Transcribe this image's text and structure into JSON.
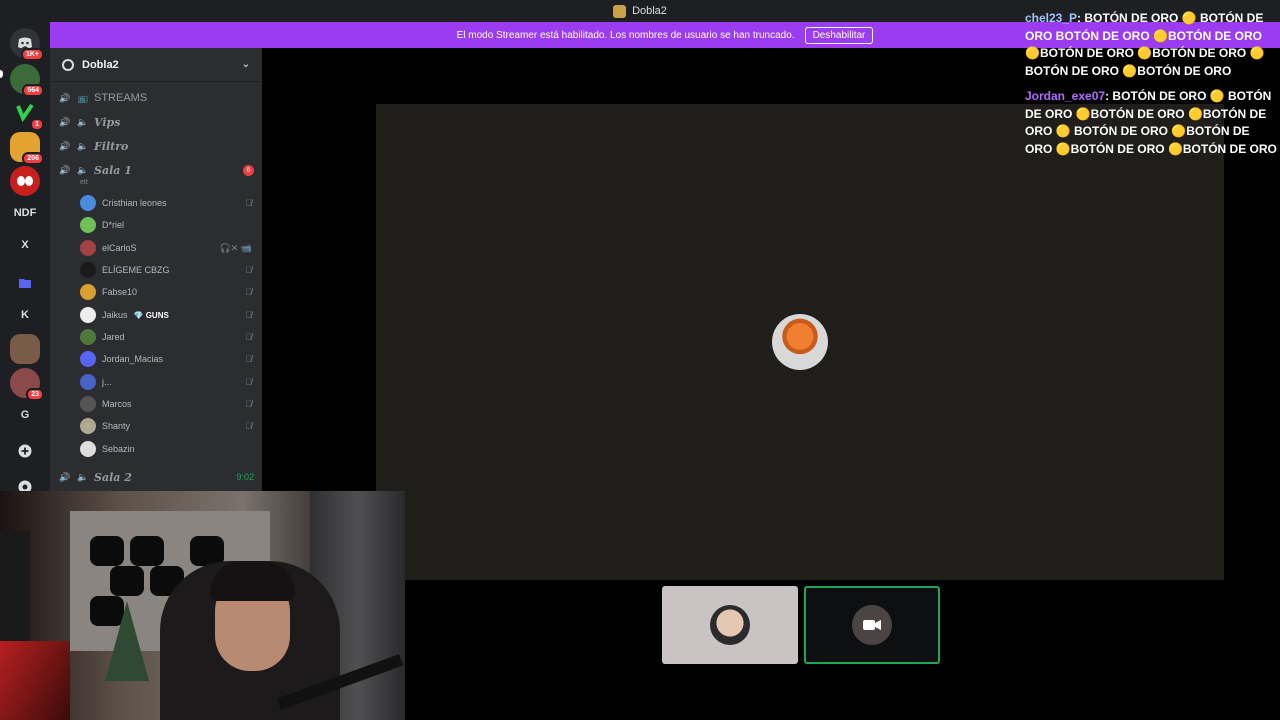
{
  "titlebar": {
    "title": "Dobla2"
  },
  "banner": {
    "text": "El modo Streamer está habilitado. Los nombres de usuario se han truncado.",
    "button": "Deshabilitar"
  },
  "rail": {
    "items": [
      {
        "label": "",
        "badge": "1K+",
        "icon": "discord-home-icon"
      },
      {
        "label": "",
        "badge": "564",
        "icon": "server-avatar"
      },
      {
        "label": "",
        "badge": "1",
        "icon": "server-avatar"
      },
      {
        "label": "",
        "badge": "206",
        "icon": "server-avatar"
      },
      {
        "label": "",
        "badge": "",
        "icon": "spiderman-avatar"
      },
      {
        "label": "NDF",
        "badge": ""
      },
      {
        "label": "X",
        "badge": ""
      },
      {
        "label": "",
        "badge": "",
        "icon": "folder-icon"
      },
      {
        "label": "K",
        "badge": ""
      },
      {
        "label": "",
        "badge": "",
        "icon": "server-avatar"
      },
      {
        "label": "",
        "badge": "23",
        "icon": "server-avatar"
      },
      {
        "label": "G",
        "badge": ""
      },
      {
        "label": "+",
        "badge": "",
        "icon": "add-server-icon"
      },
      {
        "label": "",
        "badge": "",
        "icon": "discover-icon"
      }
    ]
  },
  "sidebar": {
    "server_name": "Dobla2",
    "channels": [
      {
        "name": "STREAMS",
        "prefix": "📺",
        "style": "plain"
      },
      {
        "name": "Vips",
        "style": "italic"
      },
      {
        "name": "Filtro",
        "style": "italic"
      },
      {
        "name": "Sala 1",
        "style": "italic",
        "badge": "6",
        "sub": "ett"
      }
    ],
    "voice_users": [
      {
        "name": "Cristhian leones",
        "color": "#4a8be0",
        "muted": true
      },
      {
        "name": "D*riel",
        "color": "#6fbf5a",
        "muted": false
      },
      {
        "name": "elCarloS",
        "color": "#a04040",
        "muted": true,
        "extra": "🎧✕ 📹"
      },
      {
        "name": "ELÍGEME CBZG",
        "color": "#1a1a1a",
        "muted": true
      },
      {
        "name": "Fabse10",
        "color": "#d8a030",
        "muted": true
      },
      {
        "name": "Jaikus",
        "color": "#eeeeee",
        "muted": true,
        "tag": "💎 GUNS"
      },
      {
        "name": "Jared",
        "color": "#4d7a3a",
        "muted": true
      },
      {
        "name": "Jordan_Macias",
        "color": "#5865f2",
        "muted": true
      },
      {
        "name": "j...",
        "color": "#4a63c9",
        "muted": true
      },
      {
        "name": "Marcos",
        "color": "#555555",
        "muted": true
      },
      {
        "name": "Shanty",
        "color": "#b0a890",
        "muted": true
      },
      {
        "name": "Sebazin",
        "color": "#dddddd",
        "muted": false
      }
    ],
    "sala2": {
      "name": "Sala 2",
      "time": "9:02"
    }
  },
  "chat": [
    {
      "user": "chel23_P",
      "text": "BOTÓN DE ORO 🟡 BOTÓN DE ORO BOTÓN DE ORO 🟡BOTÓN DE ORO 🟡BOTÓN DE ORO 🟡BOTÓN DE ORO 🟡BOTÓN DE ORO 🟡BOTÓN DE ORO"
    },
    {
      "user": "Jordan_exe07",
      "text": "BOTÓN DE ORO 🟡 BOTÓN DE ORO 🟡BOTÓN DE ORO 🟡BOTÓN DE ORO 🟡 BOTÓN DE ORO 🟡BOTÓN DE ORO 🟡BOTÓN DE ORO 🟡BOTÓN DE ORO"
    }
  ]
}
